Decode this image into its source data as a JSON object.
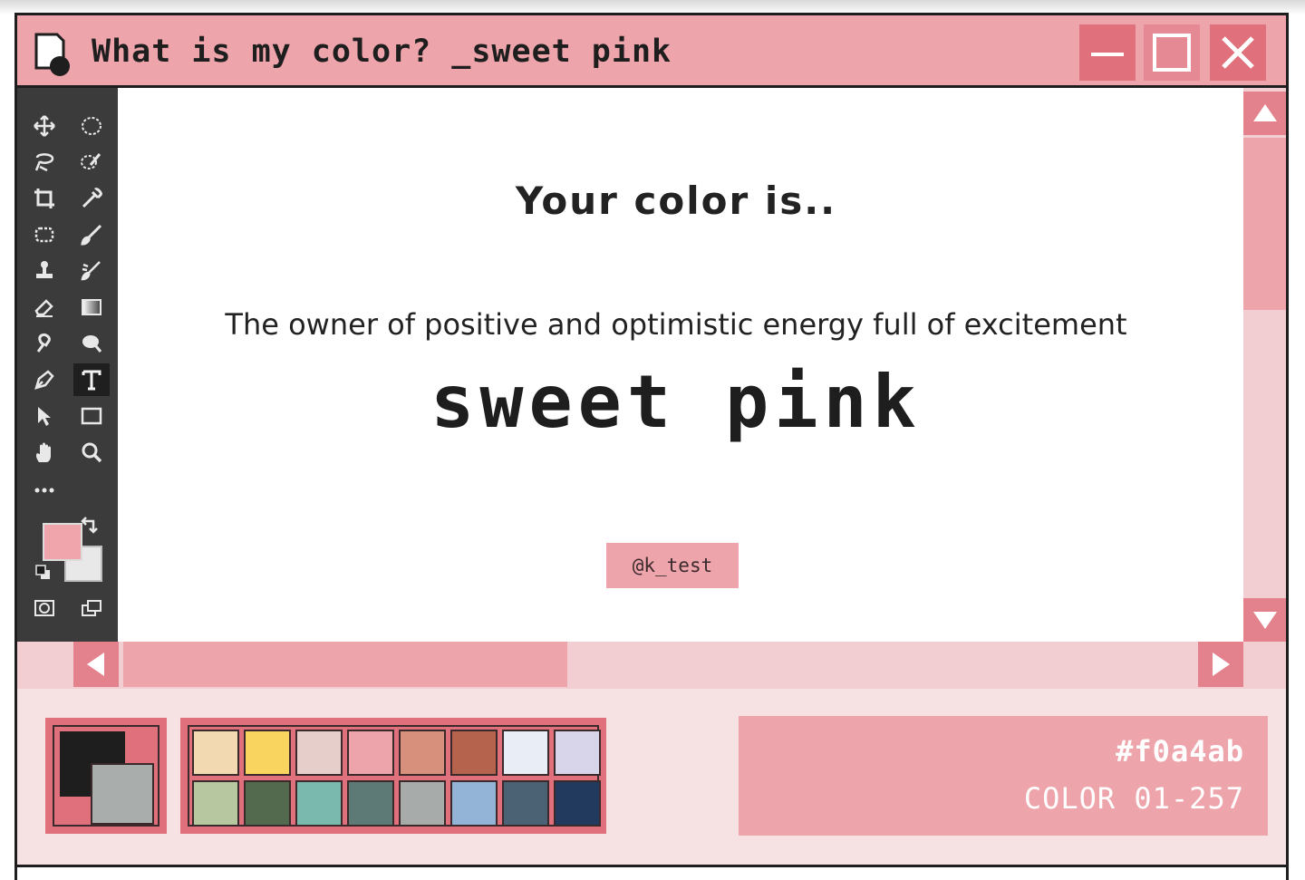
{
  "window": {
    "title": "What is my color? _sweet pink",
    "buttons": [
      "minimize",
      "maximize",
      "close"
    ]
  },
  "content": {
    "heading": "Your color is..",
    "description": "The owner of positive and optimistic energy full of excitement",
    "color_name": "sweet pink",
    "handle": "@k_test"
  },
  "tools": [
    "move-icon",
    "ellipse-marquee-icon",
    "lasso-icon",
    "quick-selection-icon",
    "crop-icon",
    "eyedropper-icon",
    "healing-patch-icon",
    "brush-icon",
    "stamp-icon",
    "history-brush-icon",
    "eraser-icon",
    "gradient-icon",
    "smudge-icon",
    "dodge-icon",
    "pen-icon",
    "type-icon",
    "path-selection-icon",
    "rectangle-icon",
    "hand-icon",
    "zoom-icon",
    "more-tools-icon"
  ],
  "active_tool": "type-icon",
  "foreground_color": "#f0a4ab",
  "background_color": "#e8e8e8",
  "palette": {
    "current_foreground": "#1e1e1e",
    "current_background": "#a9adab",
    "swatches": [
      "#f2d9b2",
      "#f9d45f",
      "#e6cfcb",
      "#eea4ab",
      "#d6907b",
      "#b5634c",
      "#e9edf5",
      "#d8d4ea",
      "#b7c79f",
      "#546a4e",
      "#79b9ae",
      "#5d7a77",
      "#a7abaa",
      "#93b4d6",
      "#4b6174",
      "#223a5e"
    ]
  },
  "info": {
    "hex": "#f0a4ab",
    "code": "COLOR 01-257"
  },
  "colors": {
    "titlebar": "#eea4ab",
    "accent": "#e0707c",
    "toolbox": "#3b3b3b",
    "panel_bg": "#f6e1e3"
  }
}
